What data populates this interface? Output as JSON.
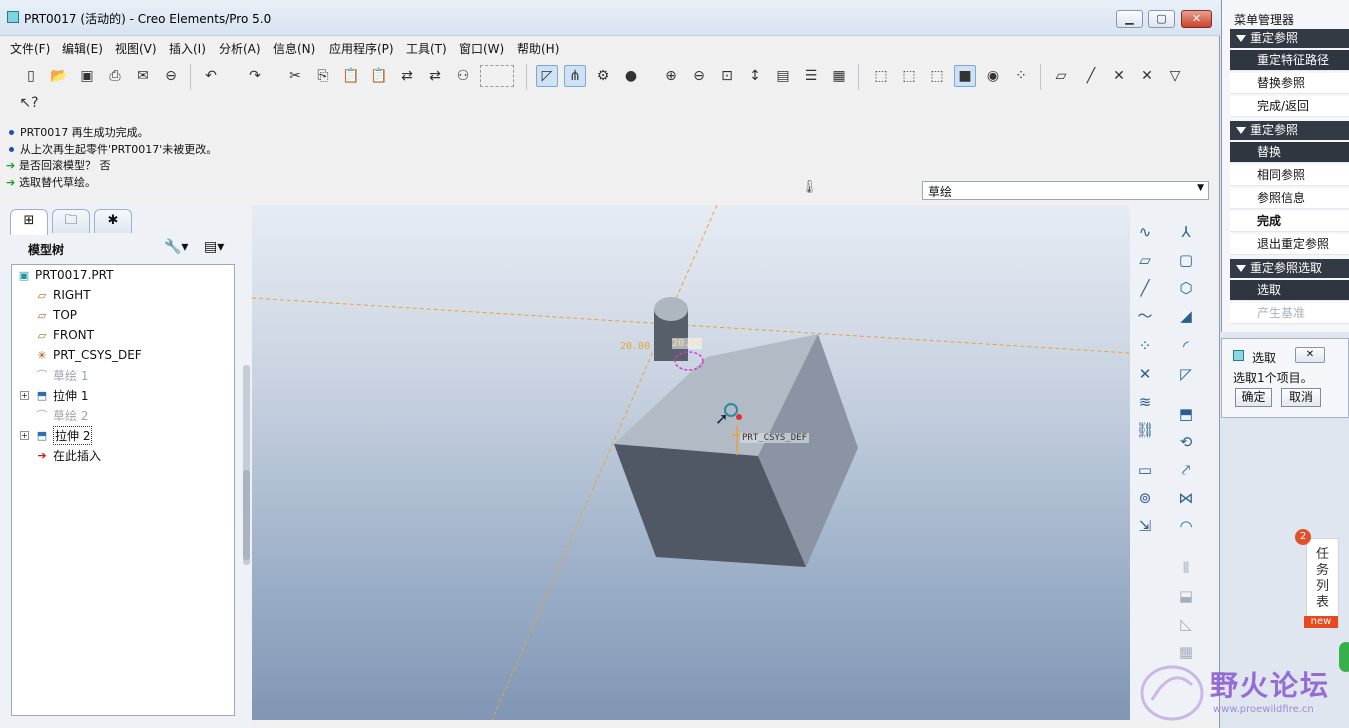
{
  "window": {
    "title": "PRT0017 (活动的) - Creo Elements/Pro 5.0"
  },
  "menubar": [
    "文件(F)",
    "编辑(E)",
    "视图(V)",
    "插入(I)",
    "分析(A)",
    "信息(N)",
    "应用程序(P)",
    "工具(T)",
    "窗口(W)",
    "帮助(H)"
  ],
  "messages": [
    {
      "type": "info",
      "text": "PRT0017 再生成功完成。"
    },
    {
      "type": "info",
      "text": "从上次再生起零件'PRT0017'未被更改。"
    },
    {
      "type": "prompt",
      "text": "是否回滚模型？ 否"
    },
    {
      "type": "prompt",
      "text": "选取替代草绘。"
    }
  ],
  "filter": {
    "value": "草绘"
  },
  "model_tree": {
    "title": "模型树",
    "items": [
      {
        "label": "PRT0017.PRT",
        "icon": "part-icon",
        "state": "normal"
      },
      {
        "label": "RIGHT",
        "icon": "datum-plane-icon",
        "state": "normal"
      },
      {
        "label": "TOP",
        "icon": "datum-plane-icon",
        "state": "normal"
      },
      {
        "label": "FRONT",
        "icon": "datum-plane-icon",
        "state": "normal"
      },
      {
        "label": "PRT_CSYS_DEF",
        "icon": "csys-icon",
        "state": "normal"
      },
      {
        "label": "草绘 1",
        "icon": "sketch-icon",
        "state": "dim"
      },
      {
        "label": "拉伸 1",
        "icon": "extrude-icon",
        "state": "normal"
      },
      {
        "label": "草绘 2",
        "icon": "sketch-icon",
        "state": "dim"
      },
      {
        "label": "拉伸 2",
        "icon": "extrude-icon",
        "state": "selected"
      },
      {
        "label": "在此插入",
        "icon": "insert-here-icon",
        "state": "normal"
      }
    ]
  },
  "viewport": {
    "dim_left": "20.00",
    "dim_right": "20.00",
    "csys_label": "PRT_CSYS_DEF"
  },
  "menu_manager": {
    "title": "菜单管理器",
    "sections": [
      {
        "header": "重定参照",
        "items": [
          {
            "label": "重定特征路径",
            "state": "selected"
          },
          {
            "label": "替换参照",
            "state": "normal"
          },
          {
            "label": "完成/返回",
            "state": "normal"
          }
        ]
      },
      {
        "header": "重定参照",
        "items": [
          {
            "label": "替换",
            "state": "selected"
          },
          {
            "label": "相同参照",
            "state": "normal"
          },
          {
            "label": "参照信息",
            "state": "normal"
          },
          {
            "label": "完成",
            "state": "bold"
          },
          {
            "label": "退出重定参照",
            "state": "normal"
          }
        ]
      },
      {
        "header": "重定参照选取",
        "items": [
          {
            "label": "选取",
            "state": "selected"
          },
          {
            "label": "产生基准",
            "state": "dim"
          }
        ]
      }
    ]
  },
  "select_dialog": {
    "title": "选取",
    "text": "选取1个项目。",
    "ok_label": "确定",
    "cancel_label": "取消"
  },
  "task_panel": {
    "label": "任务列表",
    "badge": "2",
    "new_tag": "new"
  },
  "watermark": {
    "text": "野火论坛",
    "url": "www.proewildfire.cn"
  },
  "colors": {
    "accent": "#333a44",
    "viewport_top": "#e7ecf4",
    "viewport_bottom": "#7f96b4",
    "datum_line": "#e8a33a"
  }
}
